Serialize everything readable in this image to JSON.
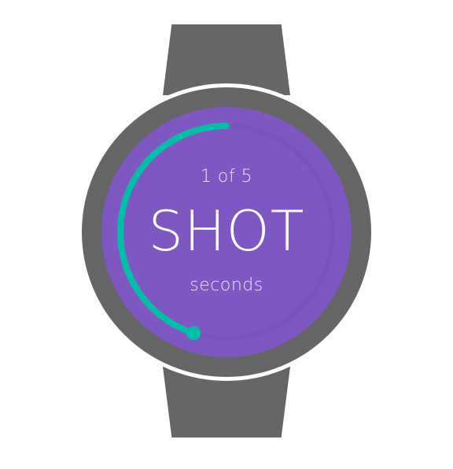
{
  "watch": {
    "counter_text": "1 of 5",
    "main_text": "SHOT",
    "unit_text": "seconds",
    "progress_fraction": 0.45
  },
  "colors": {
    "band": "#666666",
    "bezel": "#666666",
    "screen": "#7e57c2",
    "progress_arc": "#00bfa5",
    "track": "#7a53bb",
    "text": "#ffffff"
  }
}
